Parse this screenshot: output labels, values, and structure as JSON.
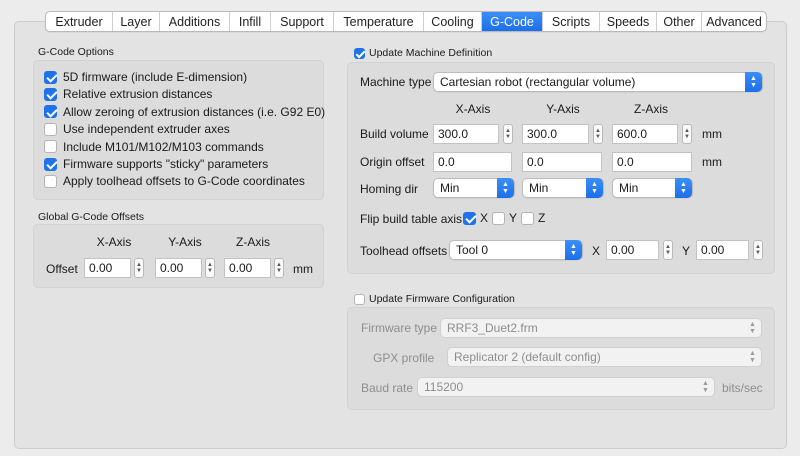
{
  "tabs": [
    "Extruder",
    "Layer",
    "Additions",
    "Infill",
    "Support",
    "Temperature",
    "Cooling",
    "G-Code",
    "Scripts",
    "Speeds",
    "Other",
    "Advanced"
  ],
  "active_tab": "G-Code",
  "gcode_options": {
    "title": "G-Code Options",
    "items": [
      {
        "label": "5D firmware (include E-dimension)",
        "checked": true
      },
      {
        "label": "Relative extrusion distances",
        "checked": true
      },
      {
        "label": "Allow zeroing of extrusion distances (i.e. G92 E0)",
        "checked": true
      },
      {
        "label": "Use independent extruder axes",
        "checked": false
      },
      {
        "label": "Include M101/M102/M103 commands",
        "checked": false
      },
      {
        "label": "Firmware supports \"sticky\" parameters",
        "checked": true
      },
      {
        "label": "Apply toolhead offsets to G-Code coordinates",
        "checked": false
      }
    ]
  },
  "global_offsets": {
    "title": "Global G-Code Offsets",
    "headers": [
      "X-Axis",
      "Y-Axis",
      "Z-Axis"
    ],
    "row_label": "Offset",
    "values": [
      "0.00",
      "0.00",
      "0.00"
    ],
    "unit": "mm"
  },
  "machine": {
    "title": "Update Machine Definition",
    "update_checked": true,
    "type_label": "Machine type",
    "type_value": "Cartesian robot (rectangular volume)",
    "axis_headers": [
      "X-Axis",
      "Y-Axis",
      "Z-Axis"
    ],
    "build_volume_label": "Build volume",
    "build_volume": [
      "300.0",
      "300.0",
      "600.0"
    ],
    "origin_offset_label": "Origin offset",
    "origin_offset": [
      "0.0",
      "0.0",
      "0.0"
    ],
    "homing_label": "Homing dir",
    "homing": [
      "Min",
      "Min",
      "Min"
    ],
    "unit": "mm",
    "flip_label": "Flip build table axis",
    "flip": [
      {
        "axis": "X",
        "checked": true
      },
      {
        "axis": "Y",
        "checked": false
      },
      {
        "axis": "Z",
        "checked": false
      }
    ],
    "toolhead_label": "Toolhead offsets",
    "toolhead_value": "Tool 0",
    "toolhead_x_label": "X",
    "toolhead_x": "0.00",
    "toolhead_y_label": "Y",
    "toolhead_y": "0.00"
  },
  "firmware": {
    "title": "Update Firmware Configuration",
    "update_checked": false,
    "type_label": "Firmware type",
    "type_value": "RRF3_Duet2.frm",
    "gpx_label": "GPX profile",
    "gpx_value": "Replicator 2 (default config)",
    "baud_label": "Baud rate",
    "baud_value": "115200",
    "baud_unit": "bits/sec"
  },
  "colors": {
    "accent": "#1f73ea"
  }
}
